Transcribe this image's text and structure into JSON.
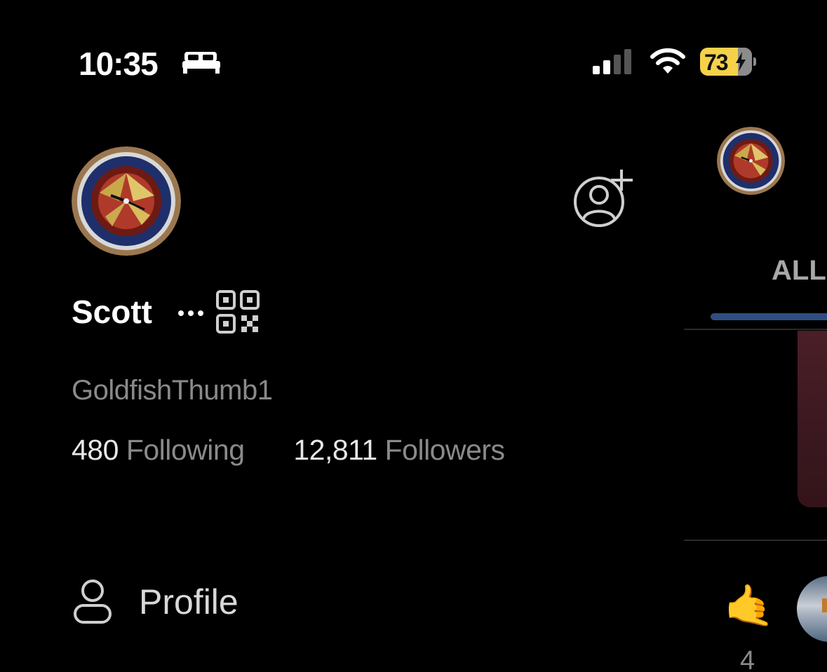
{
  "status_bar": {
    "time": "10:35",
    "battery_level": "73",
    "battery_color": "#f5d24a"
  },
  "profile": {
    "display_name": "Scott",
    "handle": "GoldfishThumb1",
    "following_count": "480",
    "following_label": "Following",
    "followers_count": "12,811",
    "followers_label": "Followers"
  },
  "menu": {
    "items": [
      {
        "label": "Profile",
        "icon": "person-icon"
      }
    ]
  },
  "background_feed": {
    "tab_label": "ALL",
    "accent": "#2f4f83",
    "reaction_emoji": "🤙",
    "reaction_count": "4"
  },
  "icons": {
    "status": [
      "bed-icon",
      "signal-icon",
      "wifi-icon",
      "battery-icon"
    ],
    "header": [
      "add-account-icon"
    ],
    "name_row": [
      "more-icon",
      "qr-code-icon"
    ]
  }
}
